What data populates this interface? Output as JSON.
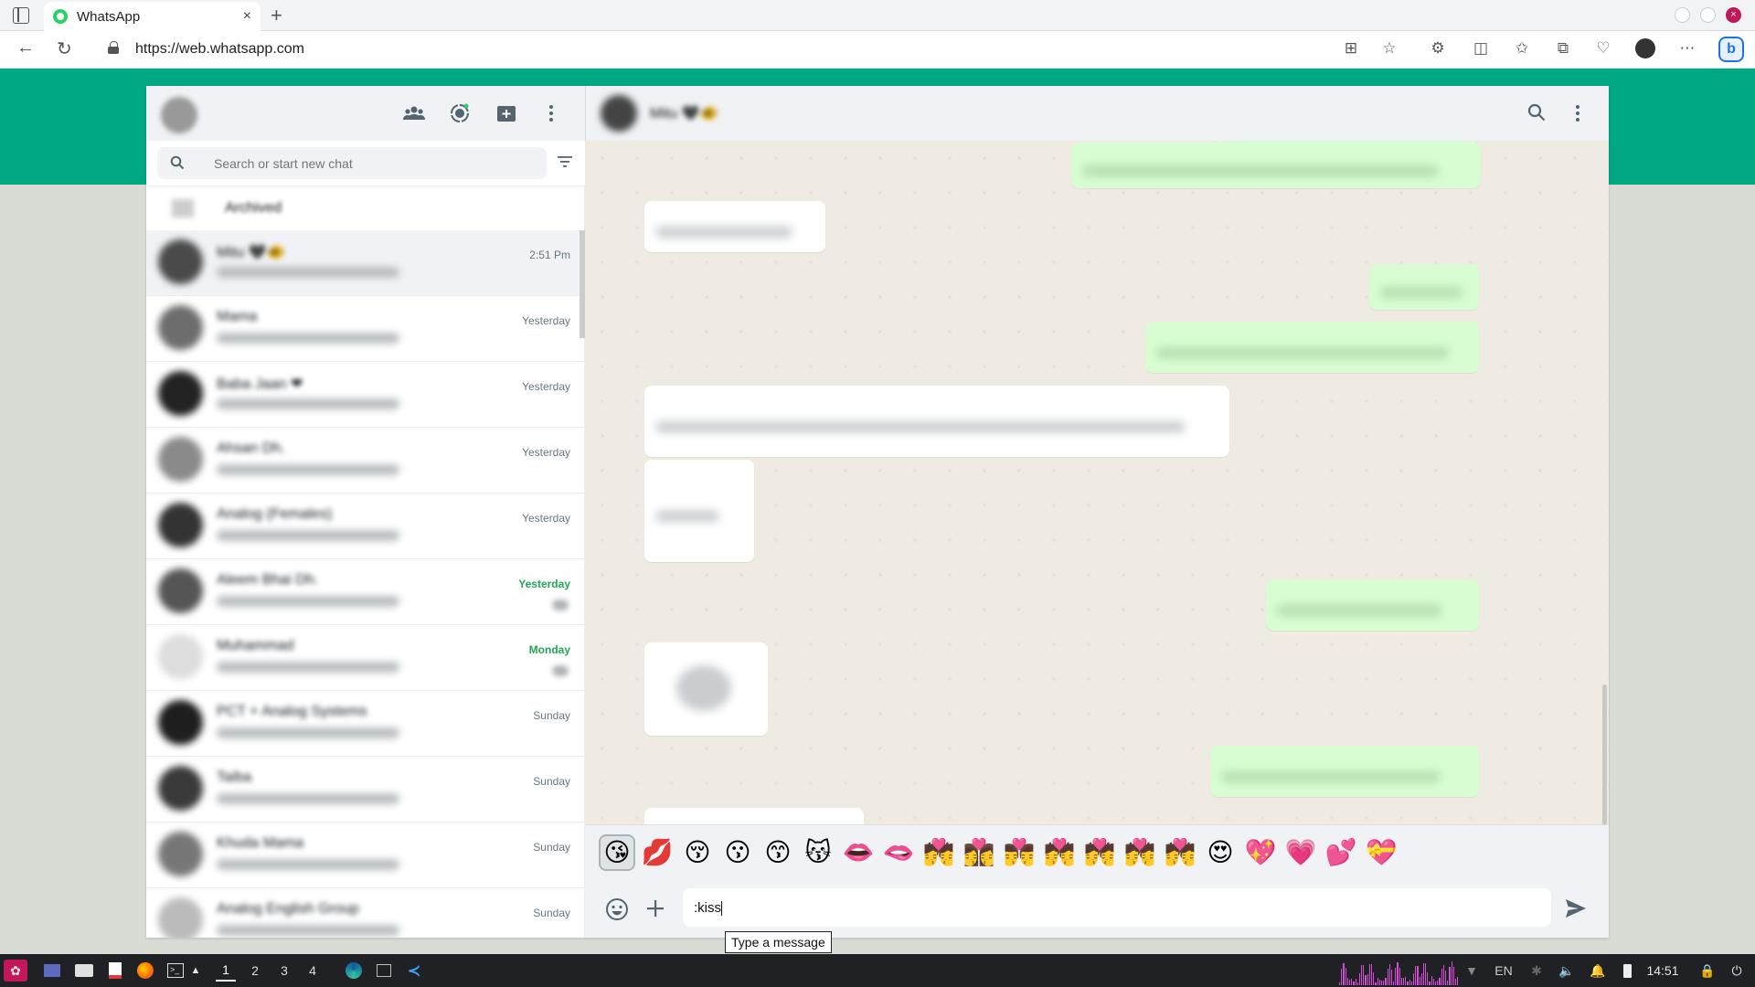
{
  "browser": {
    "tab_title": "WhatsApp",
    "tab_close": "×",
    "new_tab": "+",
    "url": "https://web.whatsapp.com",
    "win_close": "×"
  },
  "sidebar": {
    "search_placeholder": "Search or start new chat",
    "archived_label": "Archived",
    "chats": [
      {
        "name": "Mitu 🖤🐠",
        "time": "2:51 Pm",
        "time_style": "normal",
        "avatar": "#4a4a4a",
        "active": true,
        "badge": false
      },
      {
        "name": "Mama",
        "time": "Yesterday",
        "time_style": "normal",
        "avatar": "#6d6d6d",
        "active": false,
        "badge": false
      },
      {
        "name": "Baba Jaan ❤",
        "time": "Yesterday",
        "time_style": "normal",
        "avatar": "#222222",
        "active": false,
        "badge": false
      },
      {
        "name": "Ahsan Dh.",
        "time": "Yesterday",
        "time_style": "normal",
        "avatar": "#8a8a8a",
        "active": false,
        "badge": false
      },
      {
        "name": "Analog (Females)",
        "time": "Yesterday",
        "time_style": "normal",
        "avatar": "#333333",
        "active": false,
        "badge": false
      },
      {
        "name": "Aleem Bhai Dh.",
        "time": "Yesterday",
        "time_style": "green",
        "avatar": "#555555",
        "active": false,
        "badge": true
      },
      {
        "name": "Muhammad",
        "time": "Monday",
        "time_style": "green",
        "avatar": "#dddddd",
        "active": false,
        "badge": true
      },
      {
        "name": "PCT + Analog Systems",
        "time": "Sunday",
        "time_style": "normal",
        "avatar": "#1e1e1e",
        "active": false,
        "badge": false
      },
      {
        "name": "Taiba",
        "time": "Sunday",
        "time_style": "normal",
        "avatar": "#3a3a3a",
        "active": false,
        "badge": false
      },
      {
        "name": "Khuda Mama",
        "time": "Sunday",
        "time_style": "normal",
        "avatar": "#777777",
        "active": false,
        "badge": false
      },
      {
        "name": "Analog English Group",
        "time": "Sunday",
        "time_style": "normal",
        "avatar": "#bbbbbb",
        "active": false,
        "badge": false
      }
    ]
  },
  "conversation": {
    "contact_name": "Mitu 🖤🐠"
  },
  "emoji_suggestions": [
    "😘",
    "💋",
    "😚",
    "😗",
    "😙",
    "😽",
    "👄",
    "🫦",
    "💏",
    "👩‍❤️‍💋‍👩",
    "👨‍❤️‍💋‍👨",
    "💏",
    "💏",
    "💏",
    "💏",
    "😍",
    "💖",
    "💗",
    "💕",
    "💝"
  ],
  "composer": {
    "text": ":kiss",
    "tooltip": "Type a message"
  },
  "taskbar": {
    "workspaces": [
      "1",
      "2",
      "3",
      "4"
    ],
    "language": "EN",
    "clock": "14:51"
  },
  "colors": {
    "accent": "#00a884",
    "outgoing_bubble": "#d9fdd3",
    "chat_bg": "#efeae2"
  }
}
